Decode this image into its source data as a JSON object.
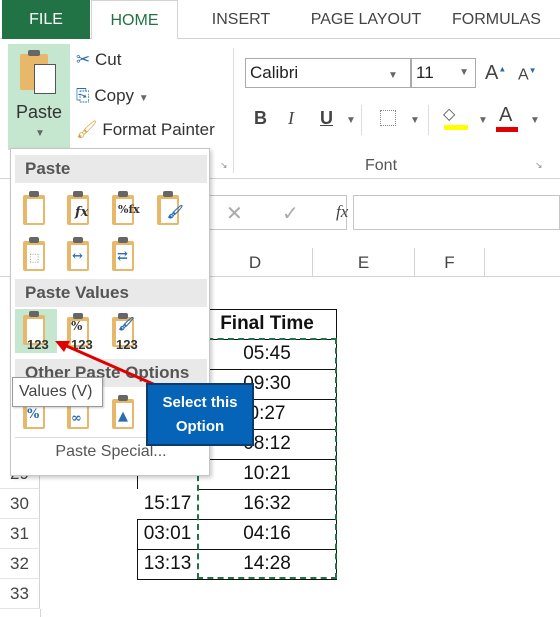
{
  "tabs": [
    {
      "label": "FILE"
    },
    {
      "label": "HOME"
    },
    {
      "label": "INSERT"
    },
    {
      "label": "PAGE LAYOUT"
    },
    {
      "label": "FORMULAS"
    }
  ],
  "clipboard": {
    "paste": "Paste",
    "cut": "Cut",
    "copy": "Copy",
    "format_painter": "Format Painter"
  },
  "font": {
    "name": "Calibri",
    "size": "11",
    "group_label": "Font",
    "bold": "B",
    "italic": "I",
    "underline": "U",
    "grow": "A",
    "shrink": "A",
    "font_color_letter": "A",
    "highlight_color": "#ffff00",
    "font_color": "#e00000"
  },
  "formula_bar": {
    "cancel": "✕",
    "enter": "✓",
    "fx": "fx",
    "value": ""
  },
  "columns": [
    "D",
    "E",
    "F"
  ],
  "rows": [
    "29",
    "30",
    "31",
    "32",
    "33"
  ],
  "table": {
    "header": "Final Time",
    "col_c": [
      {
        "row": "30",
        "value": "15:17"
      },
      {
        "row": "31",
        "value": "03:01"
      },
      {
        "row": "32",
        "value": "13:13"
      }
    ],
    "col_d": [
      "05:45",
      "09:30",
      "0:27",
      "08:12",
      "10:21",
      "16:32",
      "04:16",
      "14:28"
    ]
  },
  "paste_menu": {
    "section_paste": "Paste",
    "section_values": "Paste Values",
    "section_other": "Other Paste Options",
    "paste_special": "Paste Special...",
    "tooltip": "Values (V)",
    "value_badge": "123"
  },
  "callout": {
    "line1": "Select this",
    "line2": "Option",
    "color": "#0563b8"
  },
  "colors": {
    "excel_green": "#217346",
    "selected_highlight": "#c5e6cf",
    "copy_marquee": "#217346",
    "arrow": "#e00000"
  }
}
